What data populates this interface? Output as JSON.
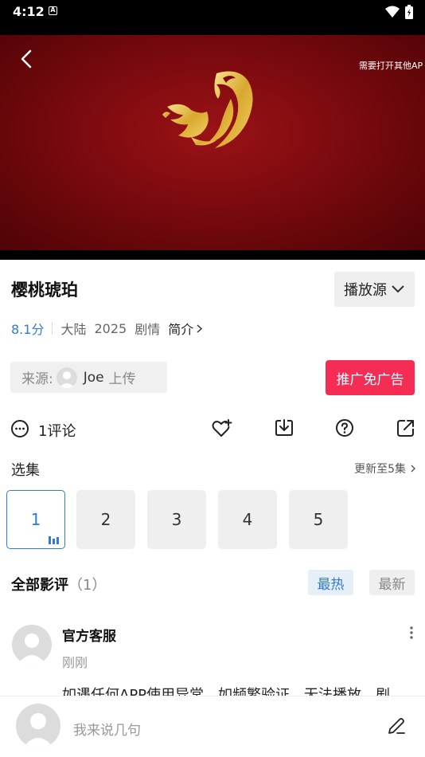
{
  "status_bar": {
    "time": "4:12",
    "notification_letter": "A"
  },
  "player": {
    "overlay_hint": "需要打开其他AP"
  },
  "movie": {
    "title": "樱桃琥珀",
    "source_button": "播放源",
    "score": "8.1分",
    "region": "大陆",
    "year": "2025",
    "genre": "剧情",
    "intro_link": "简介"
  },
  "uploader": {
    "label": "来源:",
    "name": "Joe",
    "suffix": "上传"
  },
  "ad_button": "推广免广告",
  "actions": {
    "comment_count": "1评论"
  },
  "episodes": {
    "title": "选集",
    "update_text": "更新至5集",
    "items": [
      "1",
      "2",
      "3",
      "4",
      "5"
    ]
  },
  "reviews": {
    "title": "全部影评",
    "count": "（1）",
    "hot_label": "最热",
    "new_label": "最新",
    "items": [
      {
        "author": "官方客服",
        "time": "刚刚",
        "text": "如遇任何APP使用异常，如频繁验证，无法播放，剧"
      }
    ]
  },
  "comment_bar": {
    "placeholder": "我来说几句"
  },
  "colors": {
    "accent_blue": "#2f7bd8",
    "ad_red": "#f52c54",
    "video_red": "#7b0a0e"
  }
}
